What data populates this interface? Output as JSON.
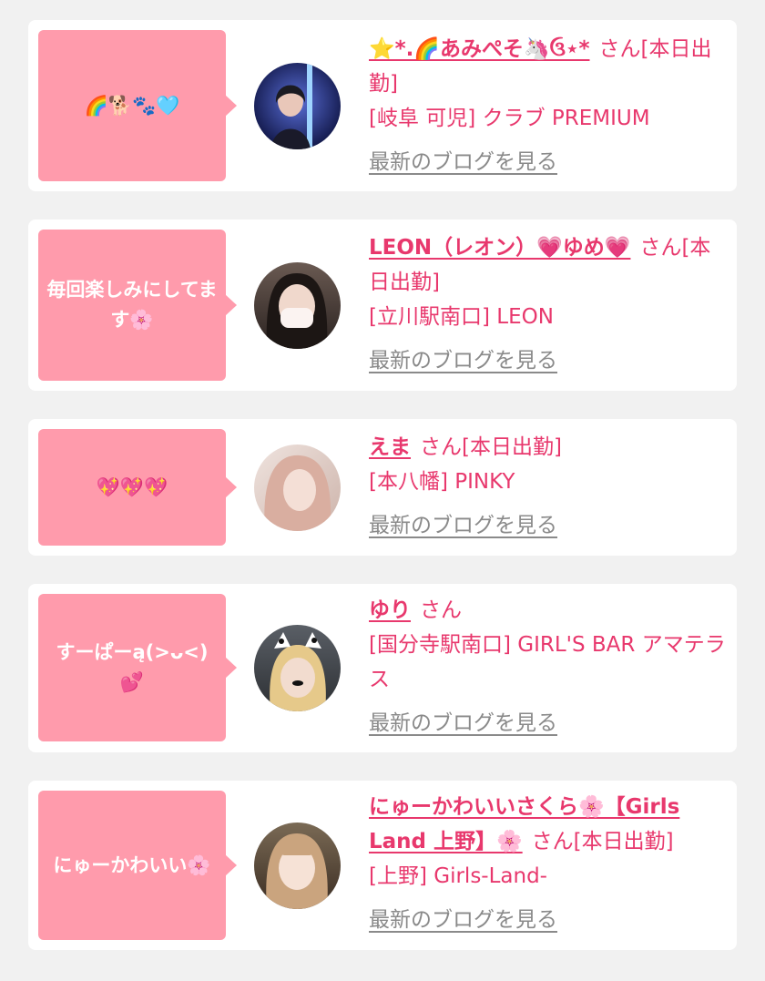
{
  "entries": [
    {
      "message": "🌈🐕🐾🩵",
      "name": "⭐*.🌈あみぺそ🦄ઉ⋆*",
      "suffix": "さん[本日出勤]",
      "shop": "[岐阜 可児] クラブ PREMIUM",
      "blog_link": "最新のブログを見る",
      "avatar_icon": "avatar-photo-icon"
    },
    {
      "message": "毎回楽しみにしてます🌸",
      "name": "LEON（レオン）💗ゆめ💗",
      "suffix": "さん[本日出勤]",
      "shop": "[立川駅南口] LEON",
      "blog_link": "最新のブログを見る",
      "avatar_icon": "avatar-photo-icon"
    },
    {
      "message": "💖💖💖",
      "name": "えま",
      "suffix": "さん[本日出勤]",
      "shop": "[本八幡] PINKY",
      "blog_link": "最新のブログを見る",
      "avatar_icon": "avatar-photo-icon"
    },
    {
      "message": "すーぱーą(>ᴗ<)💕",
      "name": "ゆり",
      "suffix": "さん",
      "shop": "[国分寺駅南口] GIRL'S BAR アマテラス",
      "blog_link": "最新のブログを見る",
      "avatar_icon": "avatar-photo-icon"
    },
    {
      "message": "にゅーかわいい🌸",
      "name": "にゅーかわいいさくら🌸【Girls Land 上野】🌸",
      "suffix": "さん[本日出勤]",
      "shop": "[上野] Girls-Land-",
      "blog_link": "最新のブログを見る",
      "avatar_icon": "avatar-photo-icon"
    }
  ],
  "colors": {
    "accent": "#e8386d",
    "bubble": "#ff9bac",
    "link_gray": "#8a8a8a",
    "background": "#f1f1f1"
  }
}
